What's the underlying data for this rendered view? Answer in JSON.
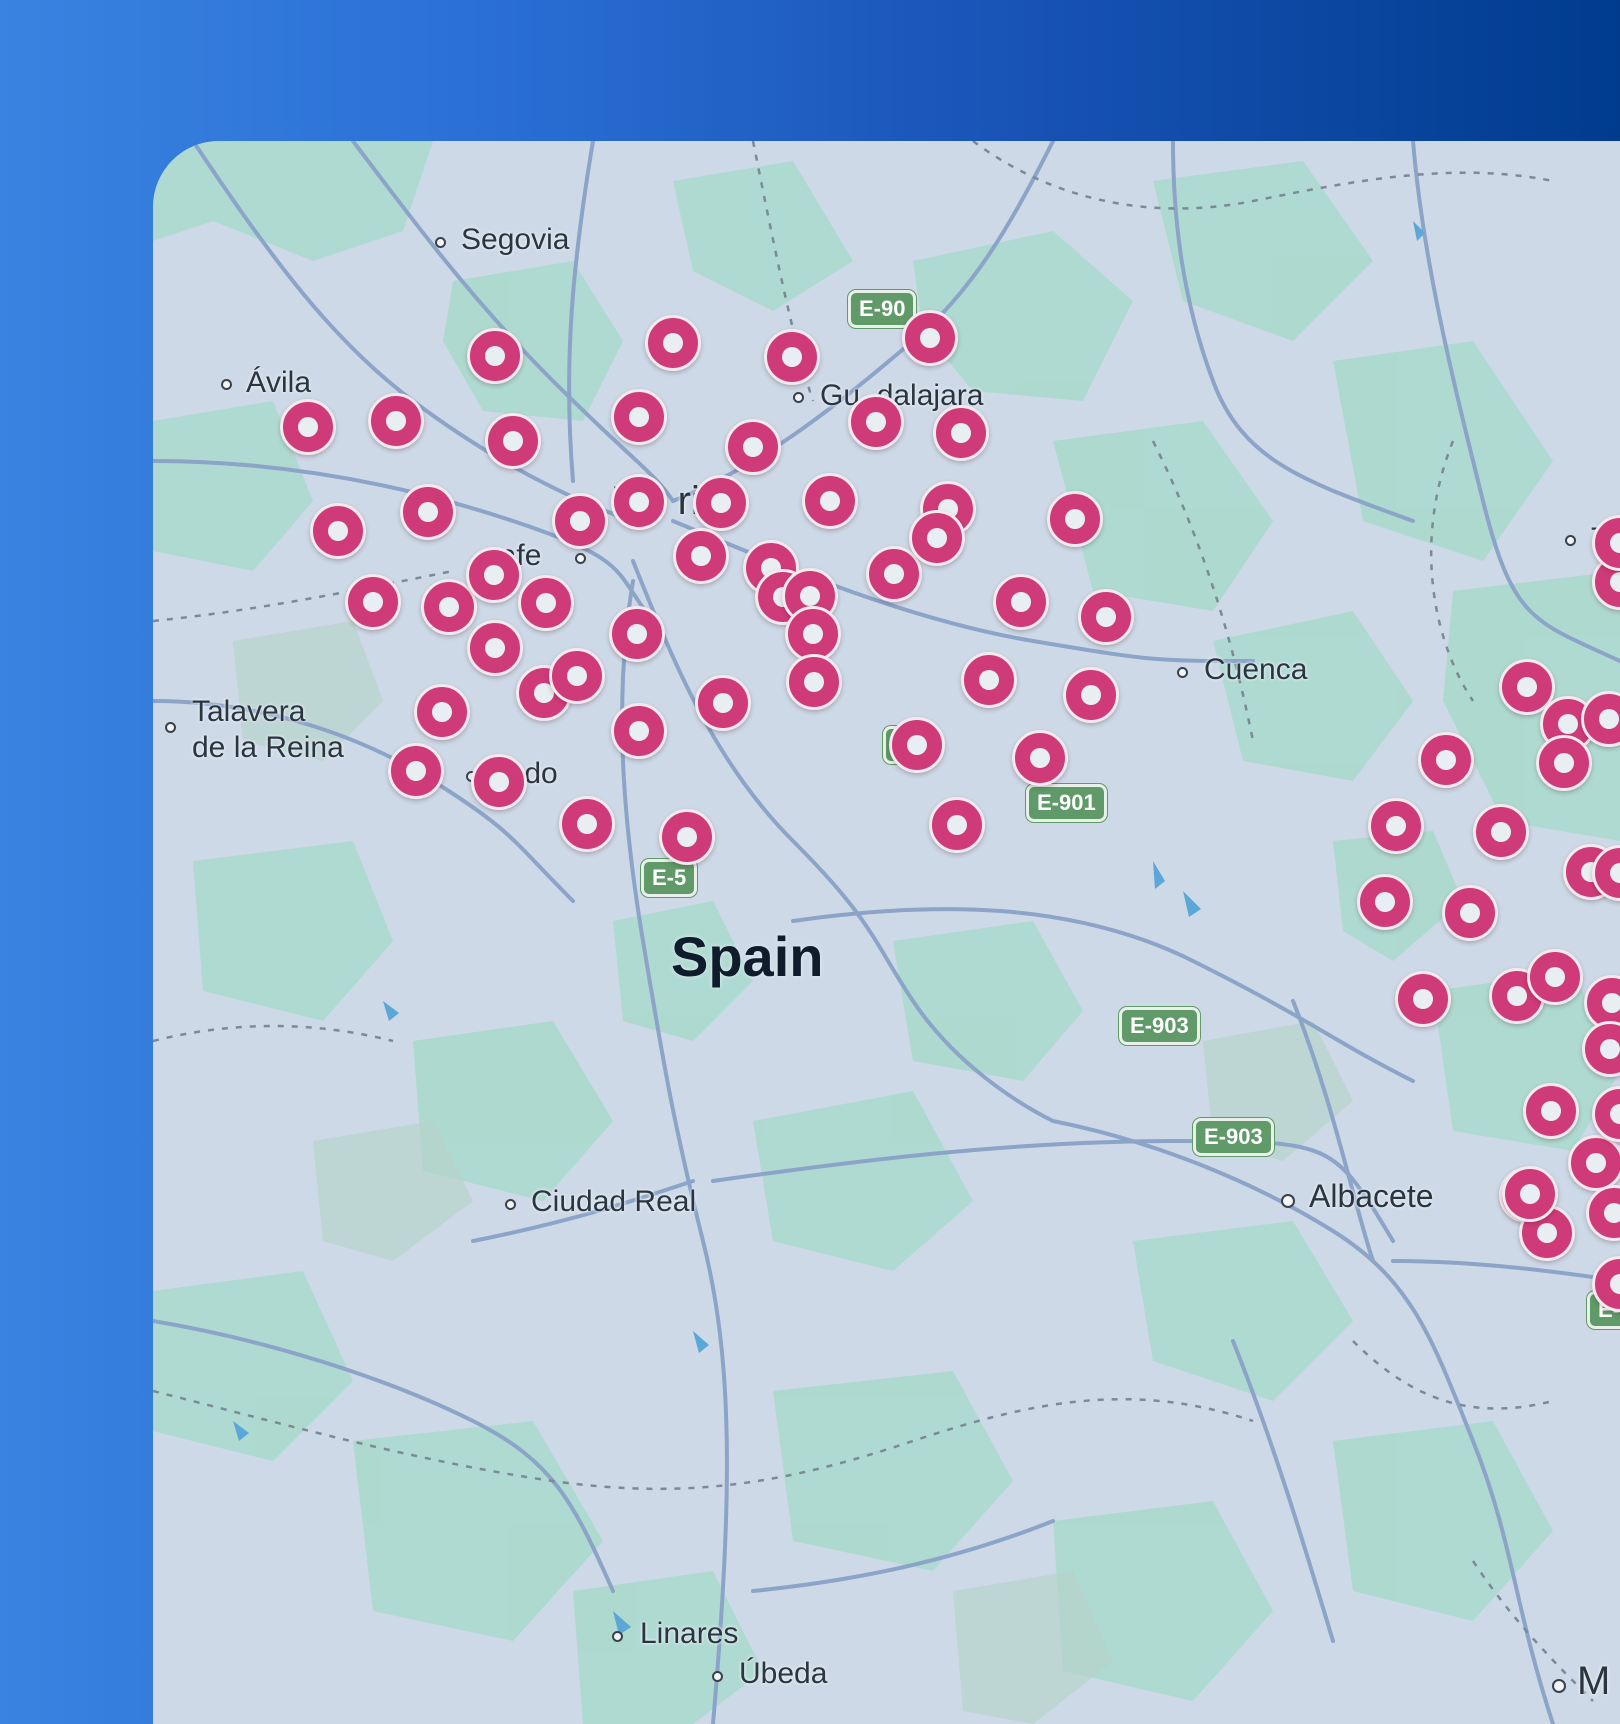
{
  "colors": {
    "marker": "#cf3b78",
    "road_shield": "#5f9a68",
    "map_background": "#cdd9e6",
    "vegetation": "#a9d9cc"
  },
  "map": {
    "country": "Spain",
    "cities": [
      {
        "id": "segovia",
        "name": "Segovia"
      },
      {
        "id": "avila",
        "name": "Ávila"
      },
      {
        "id": "guadalajara",
        "name": "Gu  dalajara"
      },
      {
        "id": "madrid",
        "name": "M   rid"
      },
      {
        "id": "getafe",
        "name": "  afe"
      },
      {
        "id": "talavera1",
        "name": "Talavera"
      },
      {
        "id": "talavera2",
        "name": "de la Reina"
      },
      {
        "id": "toledo",
        "name": "  edo"
      },
      {
        "id": "cuenca",
        "name": "Cuenca"
      },
      {
        "id": "teruel",
        "name": "Te"
      },
      {
        "id": "ciudad_real",
        "name": "Ciudad Real"
      },
      {
        "id": "albacete",
        "name": "Albacete"
      },
      {
        "id": "linares",
        "name": "Linares"
      },
      {
        "id": "ubeda",
        "name": "Úbeda"
      },
      {
        "id": "murcia",
        "name": "M"
      }
    ],
    "road_shields": [
      {
        "id": "e90",
        "label": "E-90"
      },
      {
        "id": "e901",
        "label": "E-901"
      },
      {
        "id": "e903a",
        "label": "E-903"
      },
      {
        "id": "e903b",
        "label": "E-903"
      },
      {
        "id": "e5",
        "label": "E-5"
      },
      {
        "id": "eright",
        "label": "E-"
      },
      {
        "id": "e0",
        "label": "0"
      }
    ],
    "marker_count": 75
  }
}
